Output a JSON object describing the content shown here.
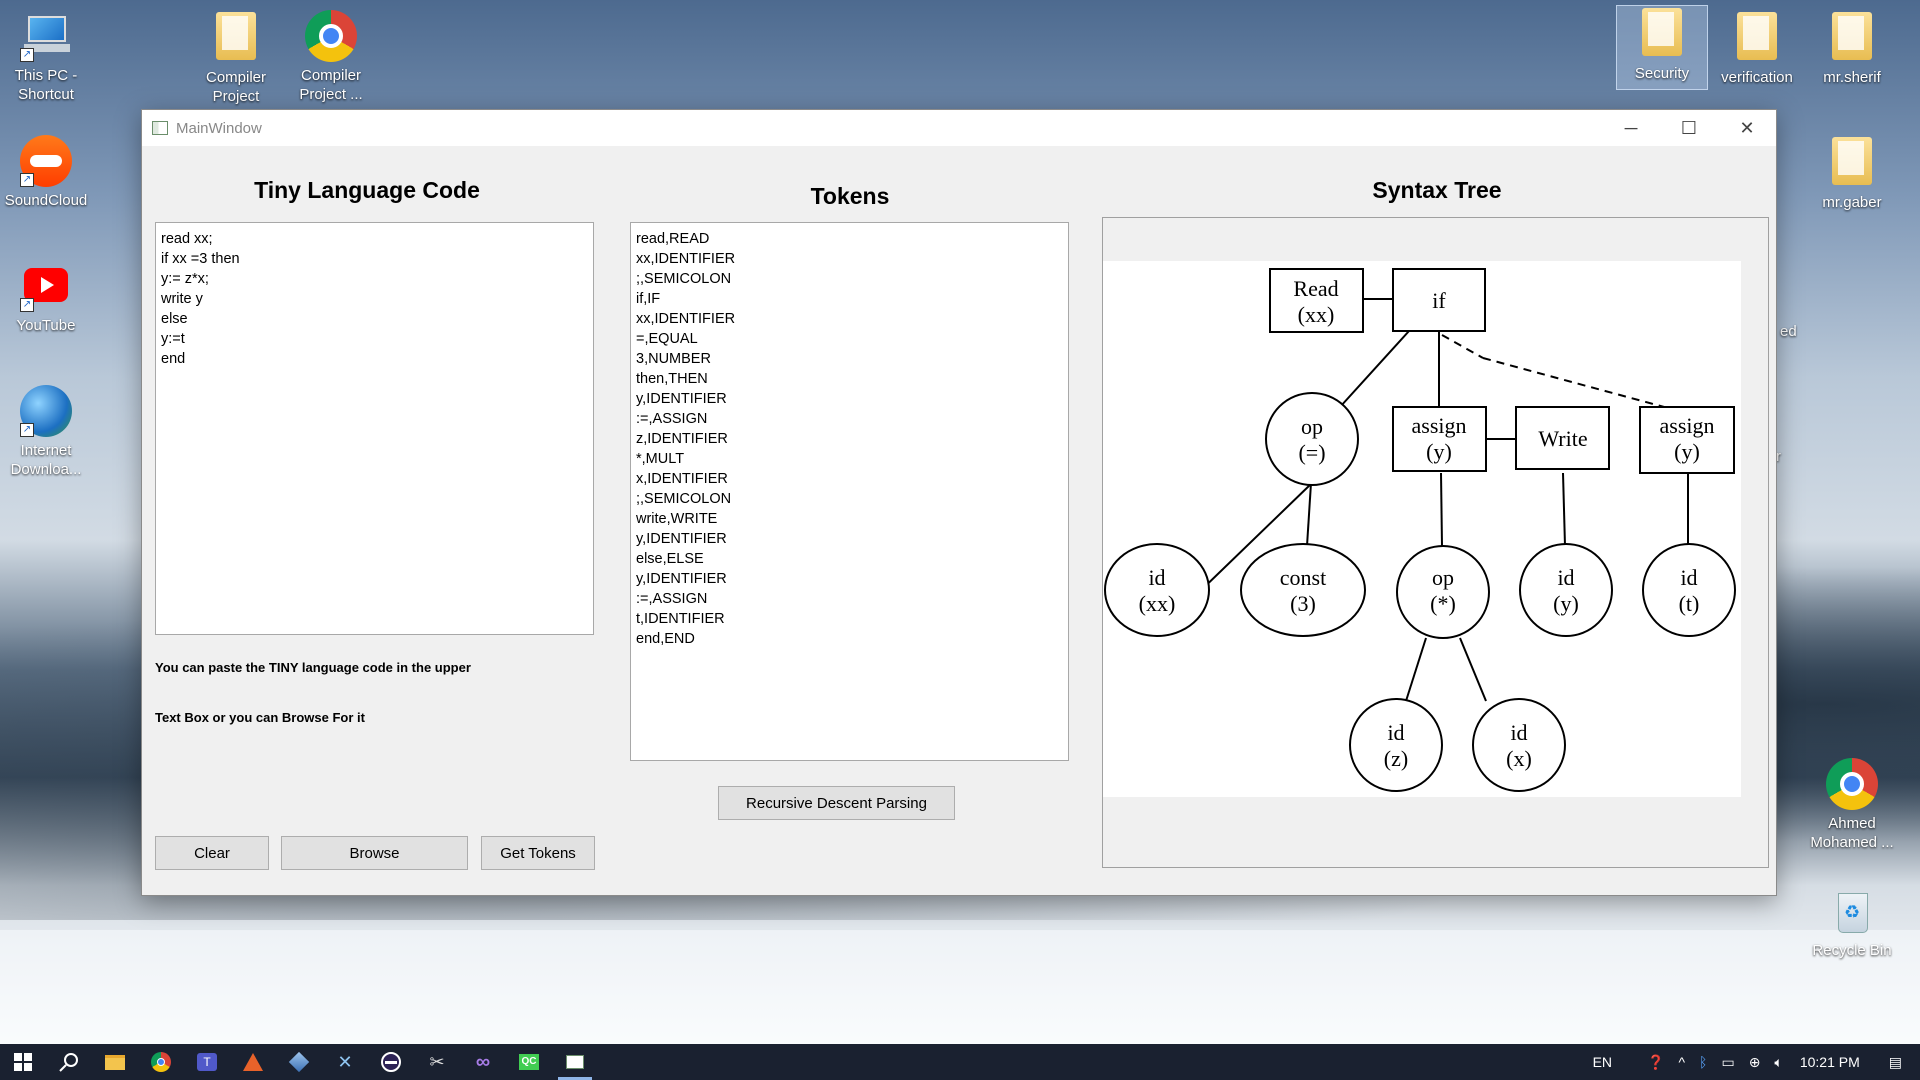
{
  "desktop": {
    "icons_left": [
      {
        "label": "This PC -\nShortcut",
        "icon": "computer-icon"
      },
      {
        "label": "SoundCloud",
        "icon": "soundcloud-icon"
      },
      {
        "label": "YouTube",
        "icon": "youtube-icon"
      },
      {
        "label": "Internet\nDownloa...",
        "icon": "internet-download-manager-icon"
      }
    ],
    "icons_top": [
      {
        "label": "Compiler\nProject",
        "icon": "folder-icon"
      },
      {
        "label": "Compiler\nProject ...",
        "icon": "chrome-icon"
      }
    ],
    "icons_right": [
      {
        "label": "Security",
        "icon": "folder-icon"
      },
      {
        "label": "verification",
        "icon": "folder-icon"
      },
      {
        "label": "mr.sherif",
        "icon": "folder-icon"
      },
      {
        "label": "mr.gaber",
        "icon": "folder-icon"
      },
      {
        "label": "Ahmed\nMohamed ...",
        "icon": "chrome-icon"
      },
      {
        "label": "Recycle Bin",
        "icon": "recycle-bin-icon"
      }
    ],
    "partial_labels": [
      "ed",
      "r"
    ]
  },
  "window": {
    "title": "MainWindow",
    "controls": {
      "minimize": "─",
      "maximize": "☐",
      "close": "✕"
    },
    "code_section": {
      "title": "Tiny Language Code",
      "code": "read xx;\nif xx =3 then\ny:= z*x;\nwrite y\nelse\ny:=t\nend",
      "hint_line1": "You can paste the TINY language code in the upper",
      "hint_line2": "Text Box or you can Browse For it",
      "buttons": {
        "clear": "Clear",
        "browse": "Browse",
        "get_tokens": "Get Tokens"
      }
    },
    "tokens_section": {
      "title": "Tokens",
      "tokens": [
        "read,READ",
        "xx,IDENTIFIER",
        ";,SEMICOLON",
        "if,IF",
        "xx,IDENTIFIER",
        "=,EQUAL",
        "3,NUMBER",
        "then,THEN",
        "y,IDENTIFIER",
        ":=,ASSIGN",
        "z,IDENTIFIER",
        "*,MULT",
        "x,IDENTIFIER",
        ";,SEMICOLON",
        "write,WRITE",
        "y,IDENTIFIER",
        "else,ELSE",
        "y,IDENTIFIER",
        ":=,ASSIGN",
        "t,IDENTIFIER",
        "end,END"
      ],
      "parse_button": "Recursive Descent Parsing"
    },
    "tree_section": {
      "title": "Syntax Tree",
      "nodes": {
        "read": [
          "Read",
          "(xx)"
        ],
        "if": [
          "if"
        ],
        "op_eq": [
          "op",
          "(=)"
        ],
        "assign1": [
          "assign",
          "(y)"
        ],
        "write": [
          "Write"
        ],
        "assign2": [
          "assign",
          "(y)"
        ],
        "id_xx": [
          "id",
          "(xx)"
        ],
        "const3": [
          "const",
          "(3)"
        ],
        "op_mul": [
          "op",
          "(*)"
        ],
        "id_y": [
          "id",
          "(y)"
        ],
        "id_t": [
          "id",
          "(t)"
        ],
        "id_z": [
          "id",
          "(z)"
        ],
        "id_x": [
          "id",
          "(x)"
        ]
      }
    }
  },
  "taskbar": {
    "apps": [
      "start-icon",
      "search-icon",
      "file-explorer-icon",
      "chrome-icon",
      "teams-icon",
      "matlab-icon",
      "virtualbox-icon",
      "xcode-tools-icon",
      "eclipse-icon",
      "build-tools-icon",
      "visual-studio-icon",
      "qt-creator-icon",
      "mainwindow-app-icon"
    ],
    "language": "EN",
    "time": "10:21 PM"
  }
}
